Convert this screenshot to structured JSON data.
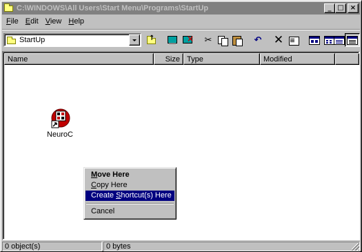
{
  "window": {
    "title": "C:\\WINDOWS\\All Users\\Start Menu\\Programs\\StartUp",
    "minimize_glyph": "_",
    "maximize_glyph": "□",
    "close_glyph": "×"
  },
  "menubar": {
    "items": [
      {
        "key": "F",
        "rest": "ile"
      },
      {
        "key": "E",
        "rest": "dit"
      },
      {
        "key": "V",
        "rest": "iew"
      },
      {
        "key": "H",
        "rest": "elp"
      }
    ]
  },
  "toolbar": {
    "location": "StartUp",
    "buttons": [
      "up-one-level",
      "map-network-drive",
      "disconnect-network-drive",
      "cut",
      "copy",
      "paste",
      "undo",
      "delete",
      "properties",
      "large-icons",
      "small-icons",
      "list",
      "details"
    ],
    "cut_glyph": "✂",
    "undo_glyph": "↶",
    "delete_glyph": "✕"
  },
  "list": {
    "columns": [
      "Name",
      "Size",
      "Type",
      "Modified"
    ],
    "items": [
      {
        "label": "NeuroC",
        "icon": "neuroc-app-icon"
      }
    ]
  },
  "context_menu": {
    "items": [
      {
        "before": "",
        "key": "M",
        "after": "ove Here"
      },
      {
        "before": "",
        "key": "C",
        "after": "opy Here"
      },
      {
        "before": "Create ",
        "key": "S",
        "after": "hortcut(s) Here"
      },
      {
        "label": "Cancel"
      }
    ]
  },
  "statusbar": {
    "objects": "0 object(s)",
    "bytes": "0 bytes"
  },
  "colors": {
    "face": "#c0c0c0",
    "inactive_title": "#808080",
    "highlight": "#000080",
    "window_bg": "#ffffff"
  }
}
